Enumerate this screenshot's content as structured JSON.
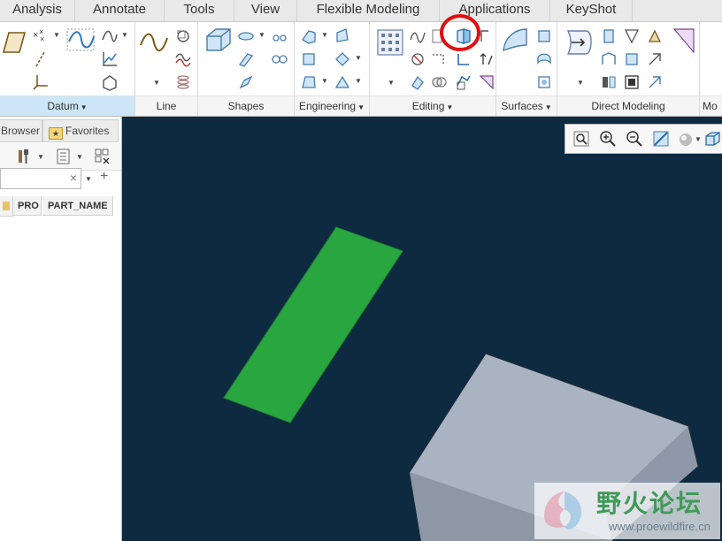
{
  "tabs": [
    "Analysis",
    "Annotate",
    "Tools",
    "View",
    "Flexible Modeling",
    "Applications",
    "KeyShot"
  ],
  "ribbon": {
    "groups": {
      "datum": "Datum",
      "line": "Line",
      "shapes": "Shapes",
      "engineering": "Engineering",
      "editing": "Editing",
      "surfaces": "Surfaces",
      "direct_modeling": "Direct Modeling",
      "truncated": "Mo"
    }
  },
  "panel": {
    "tabs": {
      "browser": "Browser",
      "favorites": "Favorites"
    },
    "search": {
      "value": "",
      "clear": "×",
      "add": "+"
    },
    "columns": [
      "PRO",
      "PART_NAME"
    ]
  },
  "watermark": {
    "brand": "野火论坛",
    "url": "www.proewildfire.cn"
  },
  "colors": {
    "viewport_bg": "#0e2a40",
    "green_surface": "#2aa640",
    "gray_solid_top": "#a9b3c2",
    "highlight_circle": "#e01010",
    "active_group": "#cce6f7"
  },
  "icons": {
    "highlighted": "split-surface-icon",
    "view_toolbar": [
      "refit-icon",
      "zoom-in-icon",
      "zoom-out-icon",
      "repaint-icon",
      "display-style-icon",
      "saved-orientations-icon"
    ]
  }
}
